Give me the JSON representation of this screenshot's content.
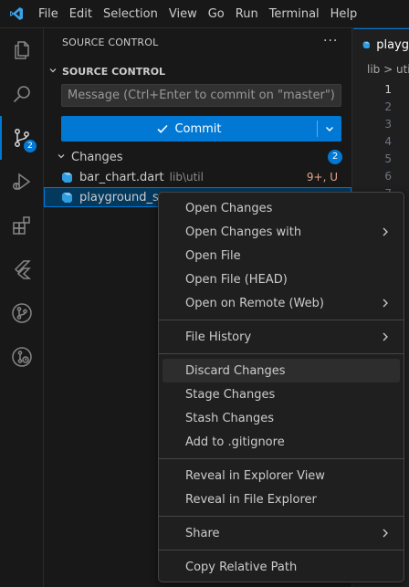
{
  "menubar": [
    "File",
    "Edit",
    "Selection",
    "View",
    "Go",
    "Run",
    "Terminal",
    "Help"
  ],
  "activity": {
    "scm_badge": "2"
  },
  "sidebar": {
    "title": "SOURCE CONTROL",
    "more": "···",
    "section": "SOURCE CONTROL",
    "message_placeholder": "Message (Ctrl+Enter to commit on \"master\")",
    "commit_label": "Commit",
    "changes_label": "Changes",
    "changes_count": "2",
    "files": [
      {
        "name": "bar_chart.dart",
        "path": "lib\\util",
        "status": "9+, U"
      },
      {
        "name": "playground_scr",
        "path": "",
        "status": ""
      }
    ]
  },
  "editor": {
    "tab_label": "playg",
    "breadcrumb": "lib > util",
    "line_numbers": [
      "1",
      "2",
      "3",
      "4",
      "5",
      "6",
      "7"
    ]
  },
  "context_menu": {
    "groups": [
      [
        {
          "label": "Open Changes",
          "submenu": false
        },
        {
          "label": "Open Changes with",
          "submenu": true
        },
        {
          "label": "Open File",
          "submenu": false
        },
        {
          "label": "Open File (HEAD)",
          "submenu": false
        },
        {
          "label": "Open on Remote (Web)",
          "submenu": true
        }
      ],
      [
        {
          "label": "File History",
          "submenu": true
        }
      ],
      [
        {
          "label": "Discard Changes",
          "submenu": false,
          "hover": true
        },
        {
          "label": "Stage Changes",
          "submenu": false
        },
        {
          "label": "Stash Changes",
          "submenu": false
        },
        {
          "label": "Add to .gitignore",
          "submenu": false
        }
      ],
      [
        {
          "label": "Reveal in Explorer View",
          "submenu": false
        },
        {
          "label": "Reveal in File Explorer",
          "submenu": false
        }
      ],
      [
        {
          "label": "Share",
          "submenu": true
        }
      ],
      [
        {
          "label": "Copy Relative Path",
          "submenu": false
        }
      ]
    ]
  },
  "colors": {
    "accent": "#0078d4",
    "status_untracked": "#e2a48b",
    "background": "#181818"
  }
}
